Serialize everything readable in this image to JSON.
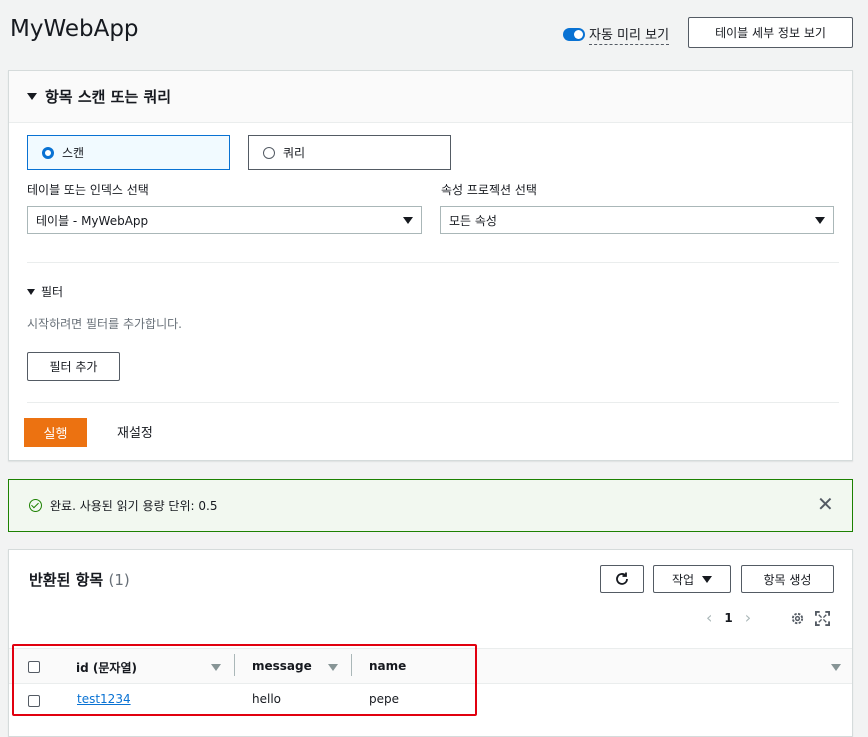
{
  "header": {
    "title": "MyWebApp",
    "auto_preview_label": "자동 미리 보기",
    "table_details_button": "테이블 세부 정보 보기"
  },
  "scan_panel": {
    "title": "항목 스캔 또는 쿼리",
    "mode_options": [
      {
        "label": "스캔",
        "selected": true
      },
      {
        "label": "쿼리",
        "selected": false
      }
    ],
    "table_select_label": "테이블 또는 인덱스 선택",
    "table_select_value": "테이블 - MyWebApp",
    "projection_label": "속성 프로젝션 선택",
    "projection_value": "모든 속성",
    "filter_title": "필터",
    "filter_hint": "시작하려면 필터를 추가합니다.",
    "add_filter_button": "필터 추가",
    "run_button": "실행",
    "reset_button": "재설정"
  },
  "flash": {
    "message": "완료. 사용된 읽기 용량 단위: 0.5",
    "status_color": "#1d8102"
  },
  "results": {
    "title": "반환된 항목",
    "count": "(1)",
    "actions_button": "작업",
    "create_item_button": "항목 생성",
    "page_number": "1",
    "columns": [
      "id (문자열)",
      "message",
      "name"
    ],
    "rows": [
      {
        "id": "test1234",
        "message": "hello",
        "name": "pepe"
      }
    ]
  },
  "colors": {
    "accent": "#0972d3",
    "run_button": "#ec7211",
    "highlight_box": "#e1000f"
  }
}
